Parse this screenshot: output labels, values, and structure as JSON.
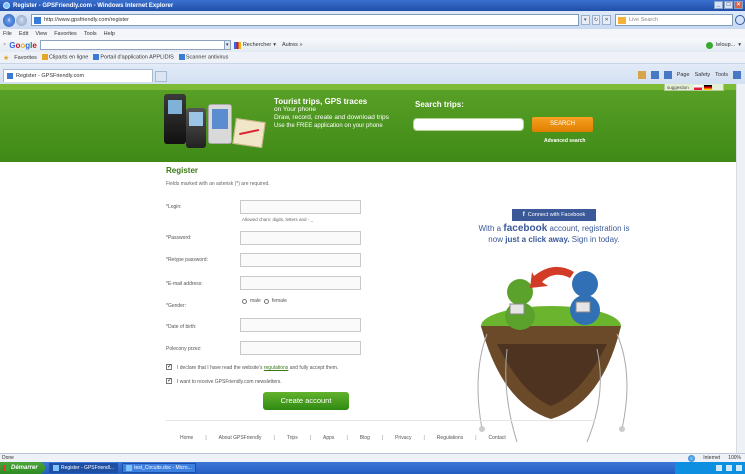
{
  "window": {
    "title": "Register - GPSFriendly.com - Windows Internet Explorer"
  },
  "address_bar": {
    "url": "http://www.gpsfriendly.com/register",
    "live_search_placeholder": "Live Search"
  },
  "menu": [
    "File",
    "Edit",
    "View",
    "Favorites",
    "Tools",
    "Help"
  ],
  "google_toolbar": {
    "logo": "Google",
    "search_label": "Rechercher",
    "more_label": "Autres »",
    "account": "leloup..."
  },
  "favorites_bar": {
    "label": "Favorites",
    "items": [
      "Cliparts en ligne",
      "Portail d'application APPLIDIS",
      "Scanner antivirus"
    ]
  },
  "tab": {
    "title": "Register - GPSFriendly.com"
  },
  "command_bar": {
    "page": "Page",
    "safety": "Safety",
    "tools": "Tools"
  },
  "banner": {
    "headline": "Tourist trips, GPS traces",
    "line2": "on Your phone",
    "line3": "Draw, record, create and download trips",
    "line4": "Use the FREE application on your phone",
    "search_title": "Search trips:",
    "search_button": "SEARCH",
    "advanced_search": "Advanced search",
    "suggestion": "suggestion"
  },
  "form": {
    "title": "Register",
    "note": "Fields marked with an asterisk (*) are required.",
    "login_label": "*Login:",
    "login_hint": "Allowed chars: digits, letters and - _",
    "password_label": "*Password:",
    "retype_label": "*Retype password:",
    "email_label": "*E-mail address:",
    "gender_label": "*Gender:",
    "gender_male": "male",
    "gender_female": "female",
    "dob_label": "*Date of birth:",
    "referral_label": "Polecony przez:",
    "terms_text_before": "I declare that I have read the website's",
    "terms_link": "regulations",
    "terms_text_after": "and fully accept them.",
    "newsletter_text": "I want to receive GPSFriendly.com newsletters.",
    "submit": "Create account"
  },
  "promo": {
    "connect_button": "Connect with Facebook",
    "with_a": "With a",
    "facebook_word": "facebook",
    "line1_rest": "account, registration is",
    "now": "now",
    "just_click": "just a click away.",
    "sign_in": "Sign in today."
  },
  "footer": {
    "links": [
      "Home",
      "About GPSFriendly",
      "Trips",
      "Apps",
      "Blog",
      "Privacy",
      "Regulations",
      "Contact"
    ]
  },
  "status_bar": {
    "left": "Done",
    "zone": "Internet",
    "zoom": "100%"
  },
  "taskbar": {
    "start": "Démarrer",
    "items": [
      "Register - GPSFriendl...",
      "test_Circuits.doc - Micro..."
    ]
  }
}
